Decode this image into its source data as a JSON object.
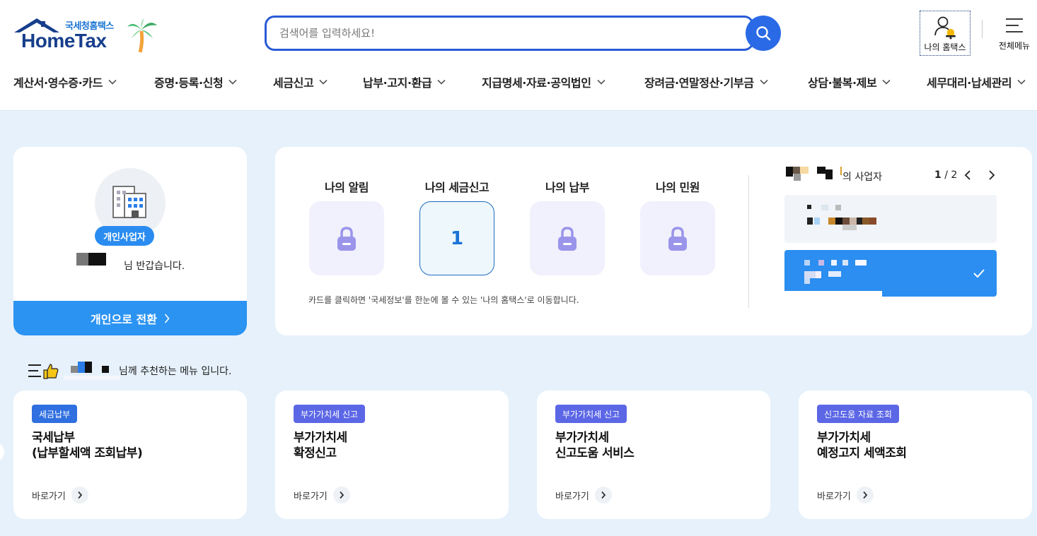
{
  "header": {
    "logo_kr": "국세청홈택스",
    "logo_en": "HomeTax",
    "search_placeholder": "검색어를 입력하세요!",
    "my_hometax": "나의 홈택스",
    "all_menu": "전체메뉴"
  },
  "gnb": [
    {
      "label": "계산서·영수증·카드"
    },
    {
      "label": "증명·등록·신청"
    },
    {
      "label": "세금신고"
    },
    {
      "label": "납부·고지·환급"
    },
    {
      "label": "지급명세·자료·공익법인"
    },
    {
      "label": "장려금·연말정산·기부금"
    },
    {
      "label": "상담·불복·제보"
    },
    {
      "label": "세무대리·납세관리"
    }
  ],
  "profile": {
    "badge": "개인사업자",
    "greeting": "님 반갑습니다.",
    "switch_label": "개인으로 전환"
  },
  "summary": {
    "tiles": [
      {
        "label": "나의 알림",
        "value": "",
        "icon": "lock-icon"
      },
      {
        "label": "나의 세금신고",
        "value": "1",
        "icon": ""
      },
      {
        "label": "나의 납부",
        "value": "",
        "icon": "lock-icon"
      },
      {
        "label": "나의 민원",
        "value": "",
        "icon": "lock-icon"
      }
    ],
    "hint": "카드를 클릭하면 '국세정보'를 한눈에 볼 수 있는 '나의 홈택스'로 이동합니다.",
    "biz_title": "의 사업자",
    "page_current": "1",
    "page_total": "/ 2"
  },
  "recommend": {
    "title": "님께 추천하는 메뉴 입니다.",
    "cards": [
      {
        "badge": "세금납부",
        "badge_color": "#2f6fe0",
        "line1": "국세납부",
        "line2": "(납부할세액 조회납부)",
        "go": "바로가기"
      },
      {
        "badge": "부가가치세 신고",
        "badge_color": "#5c67e6",
        "line1": "부가가치세",
        "line2": "확정신고",
        "go": "바로가기"
      },
      {
        "badge": "부가가치세 신고",
        "badge_color": "#5c67e6",
        "line1": "부가가치세",
        "line2": "신고도움 서비스",
        "go": "바로가기"
      },
      {
        "badge": "신고도움 자료 조회",
        "badge_color": "#5c67e6",
        "line1": "부가가치세",
        "line2": "예정고지 세액조회",
        "go": "바로가기"
      }
    ]
  },
  "colors": {
    "brand_blue": "#2a5bd7",
    "accent_blue": "#2b93f2",
    "page_bg": "#e6f1fb",
    "badge_indigo": "#5c67e6"
  }
}
